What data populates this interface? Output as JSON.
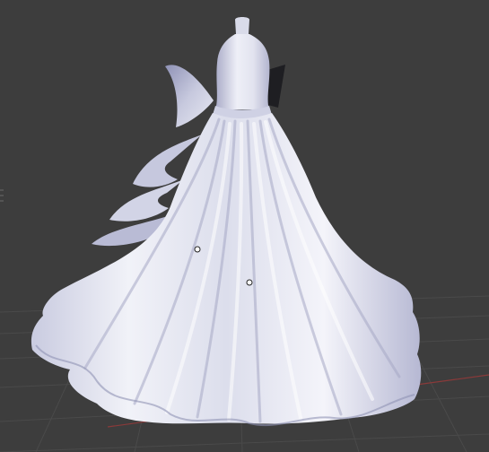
{
  "viewport": {
    "background_color": "#3d3d3d",
    "grid_line_color": "#4a4a4a",
    "x_axis_color": "#8a3a3a",
    "mesh_base_color": "#e4e5f0",
    "mesh_shadow_color": "#9a9cbd",
    "mesh_highlight_color": "#ffffff",
    "control_point_count": 2
  }
}
